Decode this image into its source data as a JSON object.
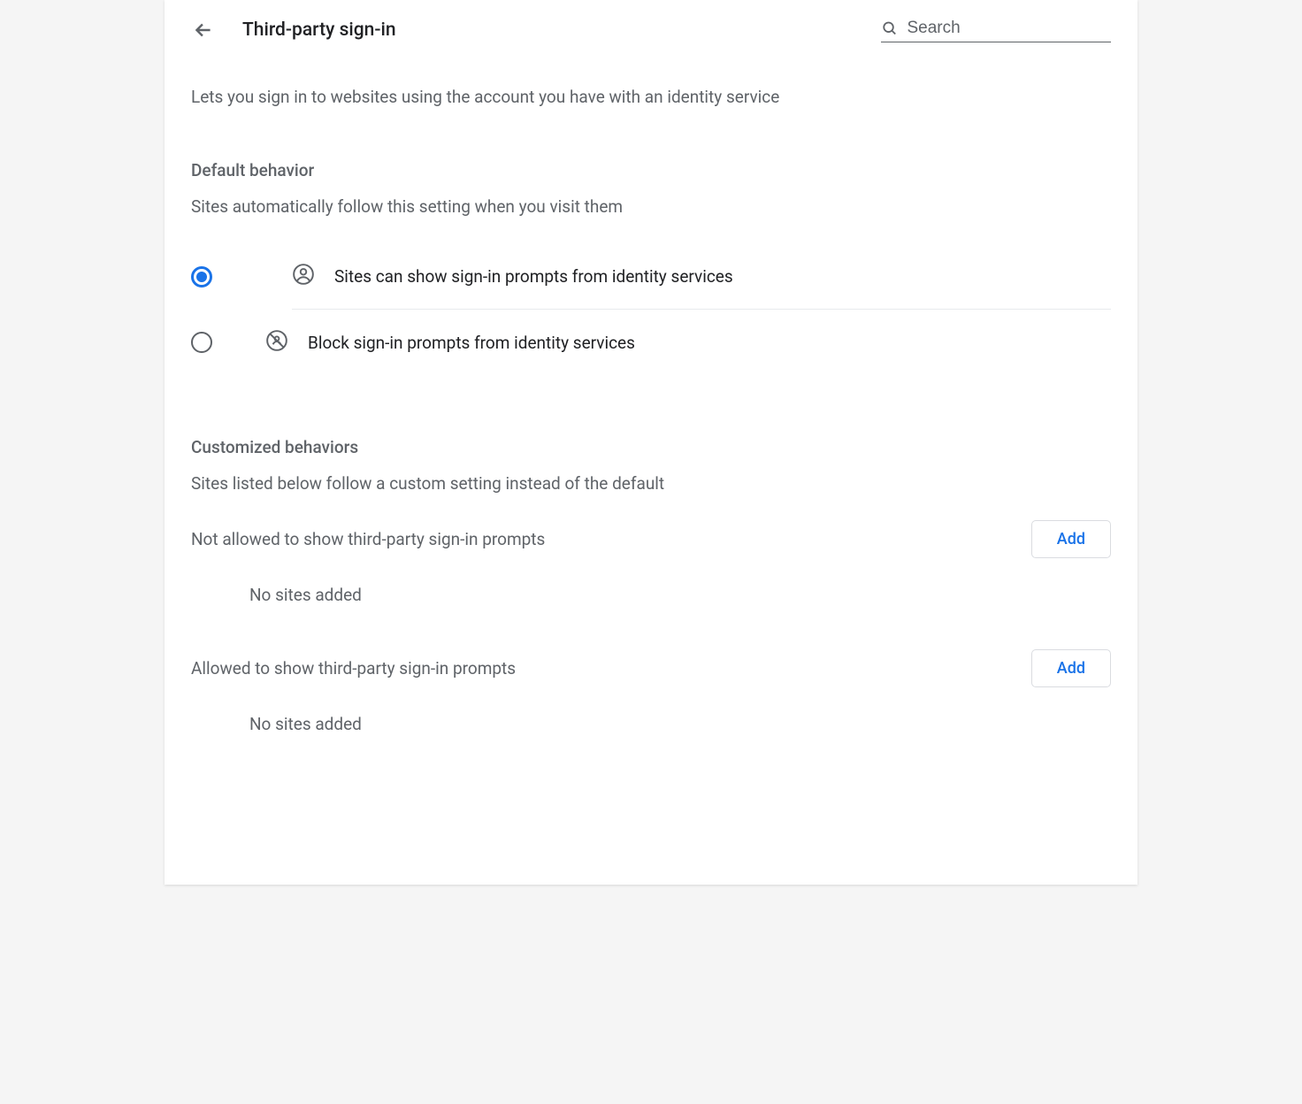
{
  "header": {
    "title": "Third-party sign-in",
    "search_placeholder": "Search"
  },
  "description": "Lets you sign in to websites using the account you have with an identity service",
  "default_behavior": {
    "title": "Default behavior",
    "subtitle": "Sites automatically follow this setting when you visit them",
    "options": [
      {
        "label": "Sites can show sign-in prompts from identity services",
        "selected": true
      },
      {
        "label": "Block sign-in prompts from identity services",
        "selected": false
      }
    ]
  },
  "customized_behaviors": {
    "title": "Customized behaviors",
    "subtitle": "Sites listed below follow a custom setting instead of the default",
    "sections": [
      {
        "label": "Not allowed to show third-party sign-in prompts",
        "add_label": "Add",
        "empty_text": "No sites added"
      },
      {
        "label": "Allowed to show third-party sign-in prompts",
        "add_label": "Add",
        "empty_text": "No sites added"
      }
    ]
  }
}
